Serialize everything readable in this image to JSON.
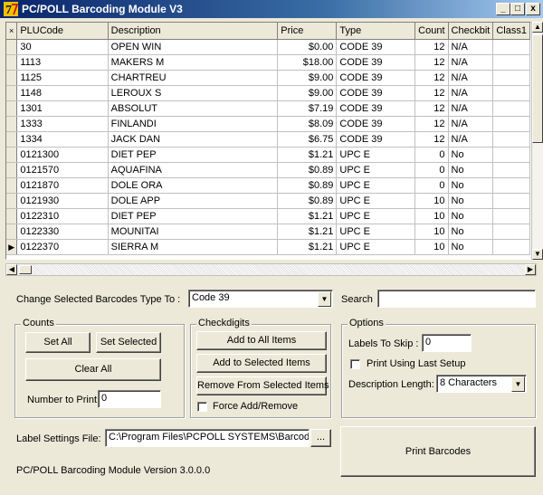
{
  "window": {
    "title": "PC/POLL Barcoding Module V3",
    "minimize_label": "_",
    "maximize_label": "□",
    "close_label": "x"
  },
  "grid": {
    "header_marker": "×",
    "columns": [
      "PLUCode",
      "Description",
      "Price",
      "Type",
      "Count",
      "Checkbit",
      "Class1"
    ],
    "current_row_marker": "▶",
    "rows": [
      {
        "plu": "30",
        "desc": "OPEN WIN",
        "price": "$0.00",
        "type": "CODE 39",
        "count": "12",
        "check": "N/A"
      },
      {
        "plu": "1113",
        "desc": "MAKERS M",
        "price": "$18.00",
        "type": "CODE 39",
        "count": "12",
        "check": "N/A"
      },
      {
        "plu": "1125",
        "desc": "CHARTREU",
        "price": "$9.00",
        "type": "CODE 39",
        "count": "12",
        "check": "N/A"
      },
      {
        "plu": "1148",
        "desc": "LEROUX S",
        "price": "$9.00",
        "type": "CODE 39",
        "count": "12",
        "check": "N/A"
      },
      {
        "plu": "1301",
        "desc": "ABSOLUT",
        "price": "$7.19",
        "type": "CODE 39",
        "count": "12",
        "check": "N/A"
      },
      {
        "plu": "1333",
        "desc": "FINLANDI",
        "price": "$8.09",
        "type": "CODE 39",
        "count": "12",
        "check": "N/A"
      },
      {
        "plu": "1334",
        "desc": "JACK DAN",
        "price": "$6.75",
        "type": "CODE 39",
        "count": "12",
        "check": "N/A"
      },
      {
        "plu": "0121300",
        "desc": "DIET PEP",
        "price": "$1.21",
        "type": "UPC E",
        "count": "0",
        "check": "No"
      },
      {
        "plu": "0121570",
        "desc": "AQUAFINA",
        "price": "$0.89",
        "type": "UPC E",
        "count": "0",
        "check": "No"
      },
      {
        "plu": "0121870",
        "desc": "DOLE ORA",
        "price": "$0.89",
        "type": "UPC E",
        "count": "0",
        "check": "No"
      },
      {
        "plu": "0121930",
        "desc": "DOLE APP",
        "price": "$0.89",
        "type": "UPC E",
        "count": "10",
        "check": "No"
      },
      {
        "plu": "0122310",
        "desc": "DIET PEP",
        "price": "$1.21",
        "type": "UPC E",
        "count": "10",
        "check": "No"
      },
      {
        "plu": "0122330",
        "desc": "MOUNITAI",
        "price": "$1.21",
        "type": "UPC E",
        "count": "10",
        "check": "No"
      },
      {
        "plu": "0122370",
        "desc": "SIERRA M",
        "price": "$1.21",
        "type": "UPC E",
        "count": "10",
        "check": "No"
      }
    ]
  },
  "type_change": {
    "label": "Change Selected Barcodes Type To :",
    "value": "Code 39"
  },
  "search": {
    "label": "Search",
    "value": ""
  },
  "counts": {
    "title": "Counts",
    "set_all": "Set All",
    "set_selected": "Set Selected",
    "clear_all": "Clear All",
    "number_label": "Number to Print:",
    "number_value": "0"
  },
  "checkdigits": {
    "title": "Checkdigits",
    "add_all": "Add to All Items",
    "add_selected": "Add to Selected Items",
    "remove_selected": "Remove From Selected Items",
    "force_label": "Force Add/Remove"
  },
  "options": {
    "title": "Options",
    "skip_label": "Labels To Skip :",
    "skip_value": "0",
    "last_setup_label": "Print Using Last Setup",
    "desc_length_label": "Description Length:",
    "desc_length_value": "8 Characters"
  },
  "label_settings": {
    "label": "Label Settings File:",
    "value": "C:\\Program Files\\PCPOLL SYSTEMS\\Barcoding.",
    "browse_label": "..."
  },
  "print_button": "Print Barcodes",
  "version": "PC/POLL Barcoding Module Version 3.0.0.0"
}
